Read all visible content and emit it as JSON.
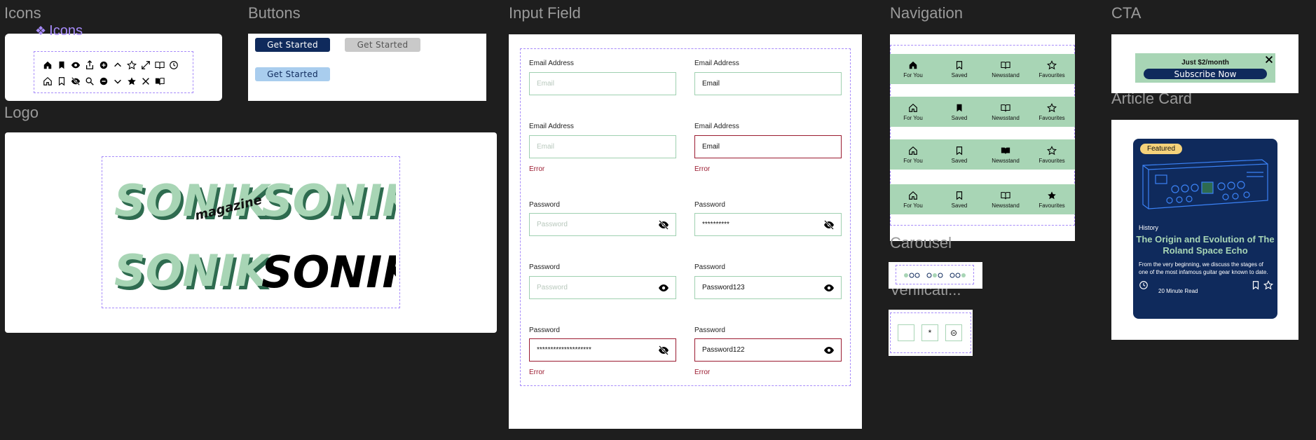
{
  "sections": {
    "icons": "Icons",
    "buttons": "Buttons",
    "input_field": "Input Field",
    "navigation": "Navigation",
    "cta": "CTA",
    "logo": "Logo",
    "article_card": "Article Card",
    "carousel": "Carousel",
    "verification": "Verificati..."
  },
  "icons_component_label": "Icons",
  "icon_row1": [
    "home-filled",
    "bookmark-filled",
    "eye",
    "share",
    "plus-circle",
    "chevron-up",
    "star-outline",
    "expand",
    "book-open",
    "clock"
  ],
  "icon_row2": [
    "home-outline",
    "bookmark-outline",
    "eye-off",
    "search",
    "minus-circle",
    "chevron-down",
    "star-filled",
    "close",
    "book"
  ],
  "buttons": {
    "primary": "Get Started",
    "disabled": "Get Started",
    "hover": "Get Started"
  },
  "inputs": {
    "r1": {
      "left": {
        "label": "Email Address",
        "value": "Email"
      },
      "right": {
        "label": "Email Address",
        "value": "Email"
      }
    },
    "r2": {
      "left": {
        "label": "Email Address",
        "value": "Email",
        "error": "Error"
      },
      "right": {
        "label": "Email Address",
        "value": "Email",
        "error": "Error"
      }
    },
    "r3": {
      "left": {
        "label": "Password",
        "value": "Password"
      },
      "right": {
        "label": "Password",
        "value": "**********"
      }
    },
    "r4": {
      "left": {
        "label": "Password",
        "value": "Password"
      },
      "right": {
        "label": "Password",
        "value": "Password123"
      }
    },
    "r5": {
      "left": {
        "label": "Password",
        "value": "********************",
        "error": "Error"
      },
      "right": {
        "label": "Password",
        "value": "Password122",
        "error": "Error"
      }
    }
  },
  "nav_labels": [
    "For You",
    "Saved",
    "Newsstand",
    "Favourites"
  ],
  "cta": {
    "price": "Just $2/month",
    "button": "Subscribe Now"
  },
  "logo": {
    "text": "SONIK",
    "sub": "magazine"
  },
  "article": {
    "badge": "Featured",
    "category": "History",
    "title": "The Origin and Evolution of The Roland Space Echo",
    "body": "From the very beginning, we discuss the stages of one of the most infamous guitar gear known to date.",
    "read": "20 Minute Read"
  },
  "verification": {
    "b2": "*",
    "b3": "⊝"
  },
  "colors": {
    "navy": "#0f2a5c",
    "mint": "#a8d5b5",
    "error": "#9b1b30",
    "purple": "#a78bfa",
    "badge": "#f5d27a"
  }
}
